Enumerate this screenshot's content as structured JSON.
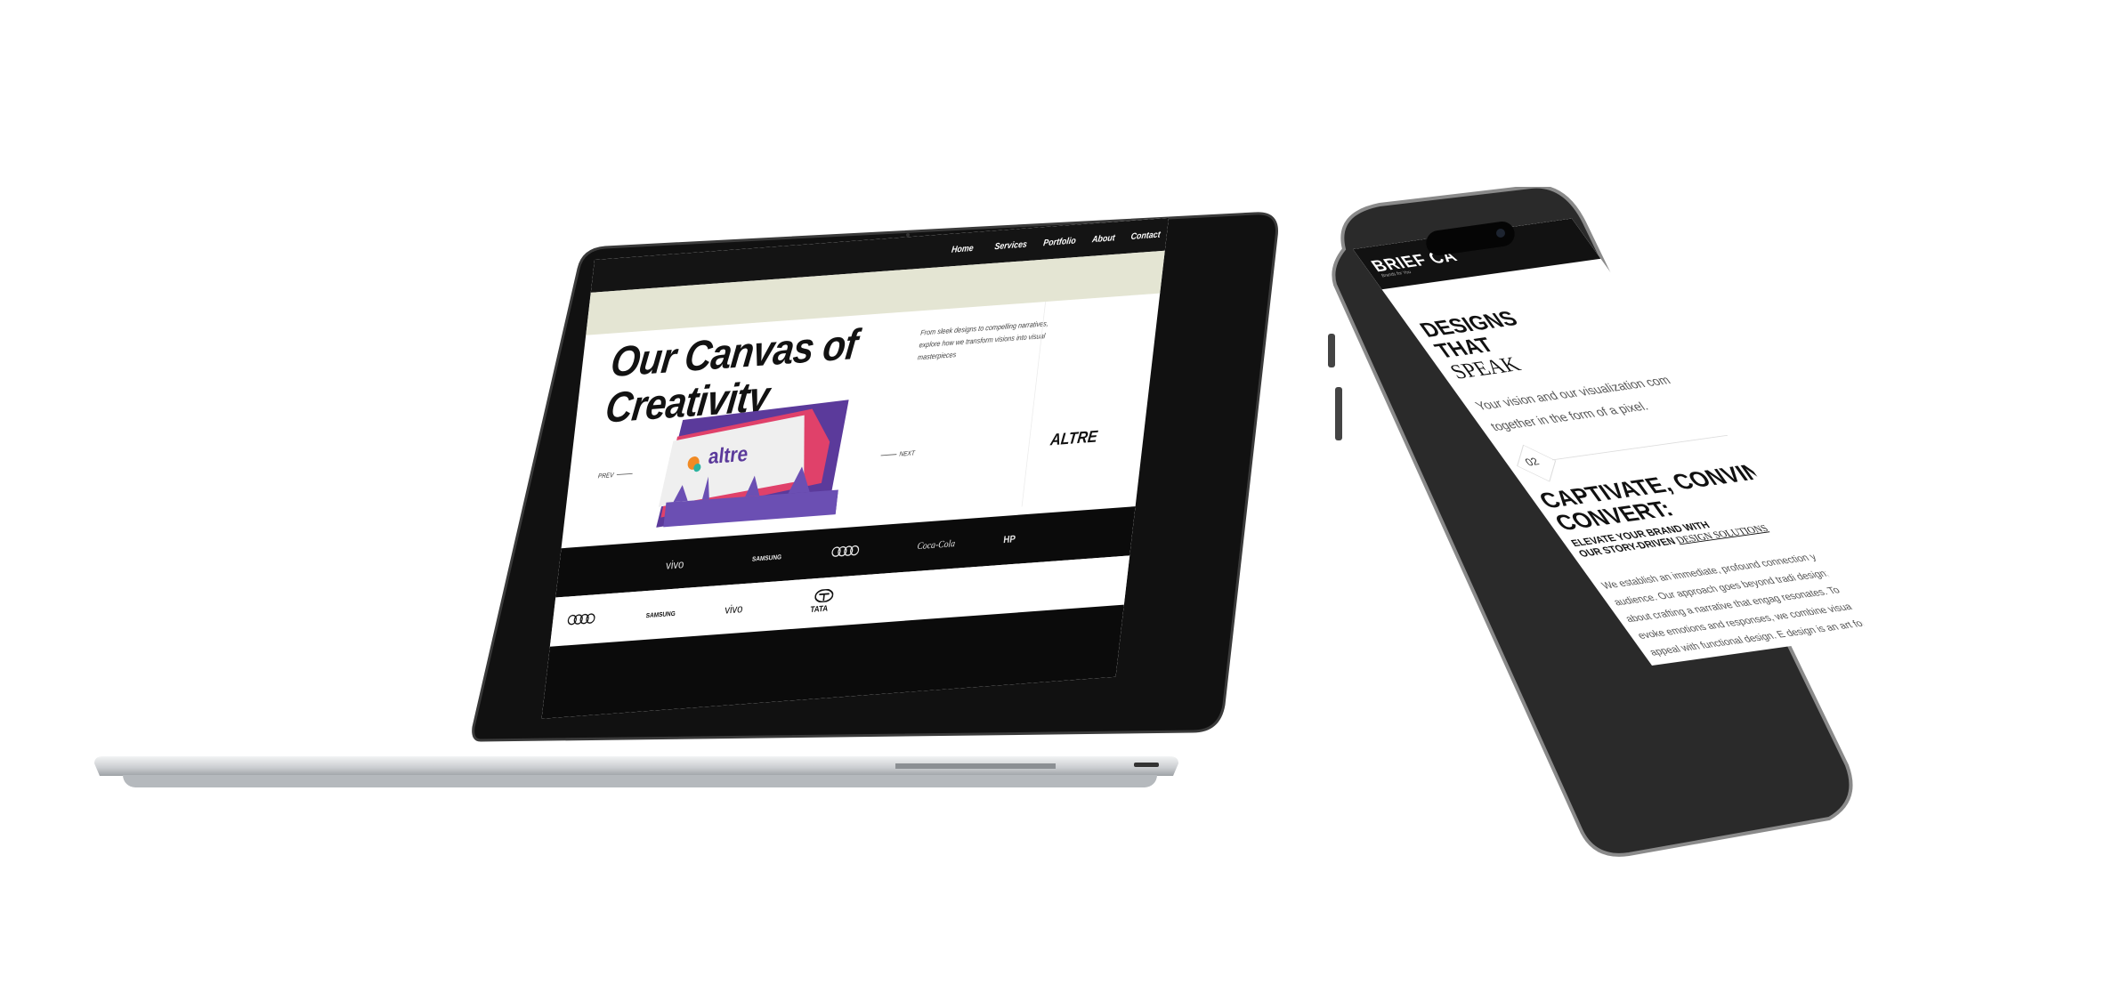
{
  "laptop": {
    "nav": [
      "Home",
      "Services",
      "Portfolio",
      "About",
      "Contact"
    ],
    "hero": {
      "title_line1": "Our Canvas of",
      "title_line2": "Creativity",
      "description": "From sleek designs to compelling narratives, explore how we transform visions into visual masterpieces"
    },
    "slider": {
      "prev": "PREV",
      "next": "NEXT",
      "project_name": "ALTRE",
      "card_logo": "altre"
    },
    "clients_row1": [
      "vivo",
      "SAMSUNG",
      "Audi",
      "Coca-Cola",
      "HP"
    ],
    "clients_row2": [
      "Audi",
      "SAMSUNG",
      "vivo",
      "TATA"
    ]
  },
  "phone": {
    "logo": "BRIEF CA",
    "tagline": "Brands for You",
    "designs_line1": "DESIGNS",
    "designs_line2": "THAT",
    "designs_line3": "SPEAK",
    "vision": "Your vision and our visualization com together in the form of a pixel.",
    "step_number": "02",
    "captivate_line1": "CAPTIVATE, CONVINC",
    "captivate_line2": "CONVERT:",
    "elevate_line1": "ELEVATE YOUR BRAND WITH",
    "elevate_line2": "OUR STORY-DRIVEN",
    "elevate_link": "DESIGN SOLUTIONS",
    "body": "We establish an immediate, profound connection your audience. Our approach goes beyond tradi design; it's about crafting a narrative that engag resonates. To evoke emotions and responses, we combine visual appeal with functional design. E design is an art form that speaks directly to th"
  },
  "colors": {
    "screen_dark": "#141414",
    "banner": "#e4e5d3",
    "aluminium": "#c9cccf",
    "brand_purple": "#5b3a9b",
    "brand_pink": "#e0416a"
  }
}
